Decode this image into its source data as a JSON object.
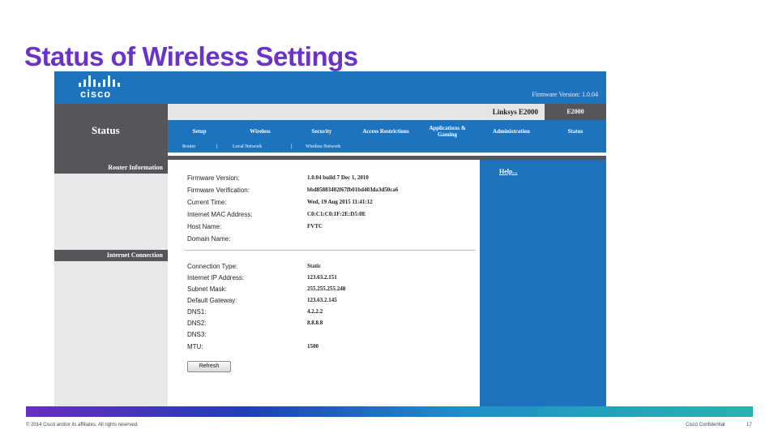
{
  "slide": {
    "title": "Status of Wireless Settings",
    "footer_left": "© 2014 Cisco and/or its affiliates. All rights reserved.",
    "footer_right": "Cisco Confidential",
    "page_number": "17"
  },
  "router": {
    "brand": "cisco",
    "firmware_version_label": "Firmware Version: 1.0.04",
    "model_label": "Linksys E2000",
    "model_tab": "E2000",
    "section": "Status",
    "menu": [
      "Setup",
      "Wireless",
      "Security",
      "Access Restrictions",
      "Applications & Gaming",
      "Administration"
    ],
    "menu_active": "Status",
    "submenu": [
      "Router",
      "Local Network",
      "Wireless Network"
    ],
    "submenu_sep": "|",
    "help_link": "Help...",
    "router_info": {
      "heading": "Router Information",
      "rows": [
        {
          "label": "Firmware Version:",
          "value": "1.0.04 build 7  Dec 1, 2010"
        },
        {
          "label": "Firmware Verification:",
          "value": "bbd85883402f67fb01bd403da3d50ca6"
        },
        {
          "label": "Current Time:",
          "value": "Wed, 19 Aug 2015 11:41:12"
        },
        {
          "label": "Internet MAC Address:",
          "value": "C0:C1:C0:1F:2E:D5:0E"
        },
        {
          "label": "Host Name:",
          "value": "FVTC"
        },
        {
          "label": "Domain Name:",
          "value": ""
        }
      ]
    },
    "internet_connection": {
      "heading": "Internet Connection",
      "rows": [
        {
          "label": "Connection Type:",
          "value": "Static"
        },
        {
          "label": "Internet IP Address:",
          "value": "123.63.2.151"
        },
        {
          "label": "Subnet Mask:",
          "value": "255.255.255.248"
        },
        {
          "label": "Default Gateway:",
          "value": "123.63.2.145"
        },
        {
          "label": "DNS1:",
          "value": "4.2.2.2"
        },
        {
          "label": "DNS2:",
          "value": "8.8.8.8"
        },
        {
          "label": "DNS3:",
          "value": ""
        },
        {
          "label": "MTU:",
          "value": "1500"
        }
      ],
      "refresh_button": "Refresh"
    }
  },
  "colors": {
    "title": "#6a33c7",
    "router_blue": "#1e73be",
    "router_gray": "#555659"
  }
}
